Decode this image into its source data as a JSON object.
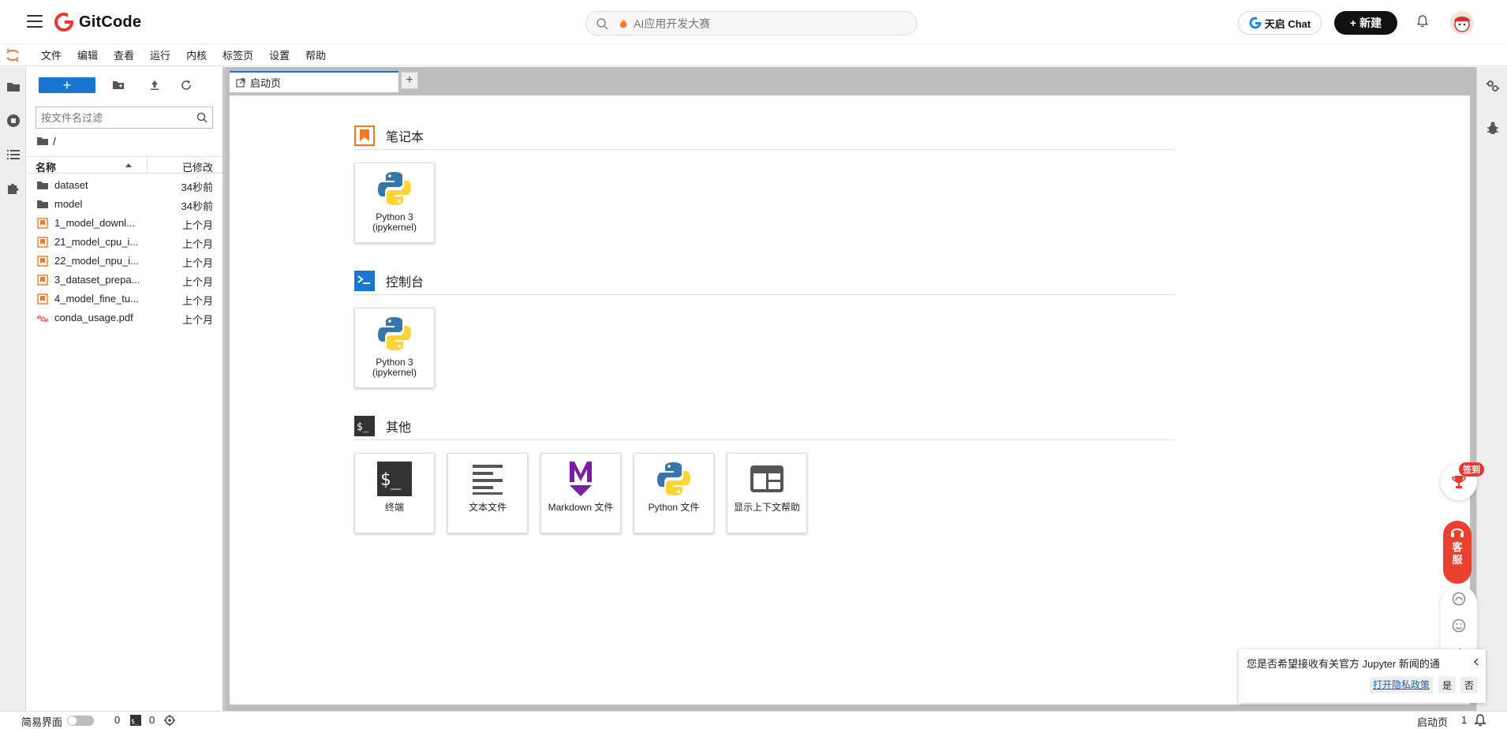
{
  "gitcode": {
    "brand": "GitCode",
    "search_placeholder": "AI应用开发大赛",
    "chat_label": "天启 Chat",
    "new_label": "新建",
    "colors": {
      "brand_red": "#e53935",
      "accent_blue": "#1976d2"
    }
  },
  "menubar": {
    "items": [
      "文件",
      "编辑",
      "查看",
      "运行",
      "内核",
      "标签页",
      "设置",
      "帮助"
    ]
  },
  "filebrowser": {
    "filter_placeholder": "按文件名过滤",
    "path": "/",
    "col_name": "名称",
    "col_modified": "已修改",
    "files": [
      {
        "name": "dataset",
        "modified": "34秒前",
        "icon": "folder-icon"
      },
      {
        "name": "model",
        "modified": "34秒前",
        "icon": "folder-icon"
      },
      {
        "name": "1_model_downl...",
        "modified": "上个月",
        "icon": "notebook-icon"
      },
      {
        "name": "21_model_cpu_i...",
        "modified": "上个月",
        "icon": "notebook-icon"
      },
      {
        "name": "22_model_npu_i...",
        "modified": "上个月",
        "icon": "notebook-icon"
      },
      {
        "name": "3_dataset_prepa...",
        "modified": "上个月",
        "icon": "notebook-icon"
      },
      {
        "name": "4_model_fine_tu...",
        "modified": "上个月",
        "icon": "notebook-icon"
      },
      {
        "name": "conda_usage.pdf",
        "modified": "上个月",
        "icon": "pdf-icon"
      }
    ]
  },
  "tab": {
    "label": "启动页"
  },
  "launcher": {
    "notebook": {
      "title": "笔记本",
      "cards": [
        {
          "label": "Python 3\n(ipykernel)"
        }
      ]
    },
    "console": {
      "title": "控制台",
      "cards": [
        {
          "label": "Python 3\n(ipykernel)"
        }
      ]
    },
    "other": {
      "title": "其他",
      "cards": [
        {
          "label": "终端"
        },
        {
          "label": "文本文件"
        },
        {
          "label": "Markdown 文件"
        },
        {
          "label": "Python 文件"
        },
        {
          "label": "显示上下文帮助"
        }
      ]
    }
  },
  "floating": {
    "sign_badge": "签到",
    "service_label": "客服"
  },
  "toast": {
    "message": "您是否希望接收有关官方 Jupyter 新闻的通",
    "privacy_link": "打开隐私政策",
    "yes": "是",
    "no": "否"
  },
  "statusbar": {
    "simple_mode": "简易界面",
    "kernels_count": "0",
    "terminals_count": "0",
    "active_tab": "启动页",
    "notification_count": "1"
  }
}
